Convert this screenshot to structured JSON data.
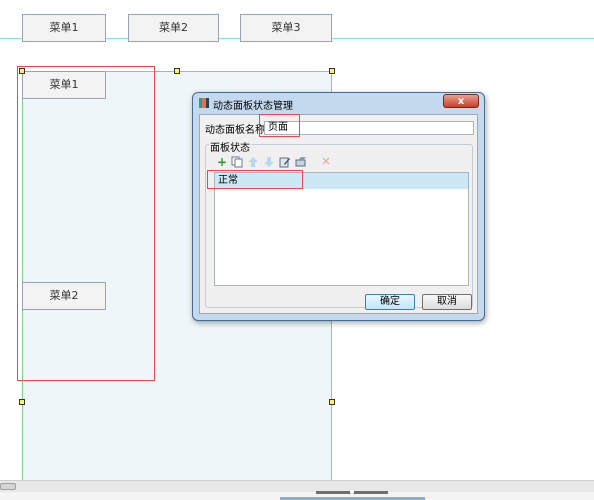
{
  "canvas": {
    "top_menu": [
      "菜单1",
      "菜单2",
      "菜单3"
    ],
    "panel_menu": [
      "菜单1",
      "菜单2"
    ]
  },
  "dialog": {
    "title": "动态面板状态管理",
    "close_glyph": "x",
    "name_label": "动态面板名称:",
    "name_value": "页面",
    "states_group_label": "面板状态",
    "toolbar_icons": [
      "add-icon",
      "duplicate-icon",
      "move-up-icon",
      "move-down-icon",
      "edit-icon",
      "edit-all-icon",
      "delete-icon"
    ],
    "states": [
      "正常"
    ],
    "ok_label": "确定",
    "cancel_label": "取消"
  },
  "colors": {
    "selection": "#cce8f4",
    "highlight_border": "#e64a4a",
    "panel_border": "#7ed38e",
    "guide": "#7fe3e3"
  }
}
